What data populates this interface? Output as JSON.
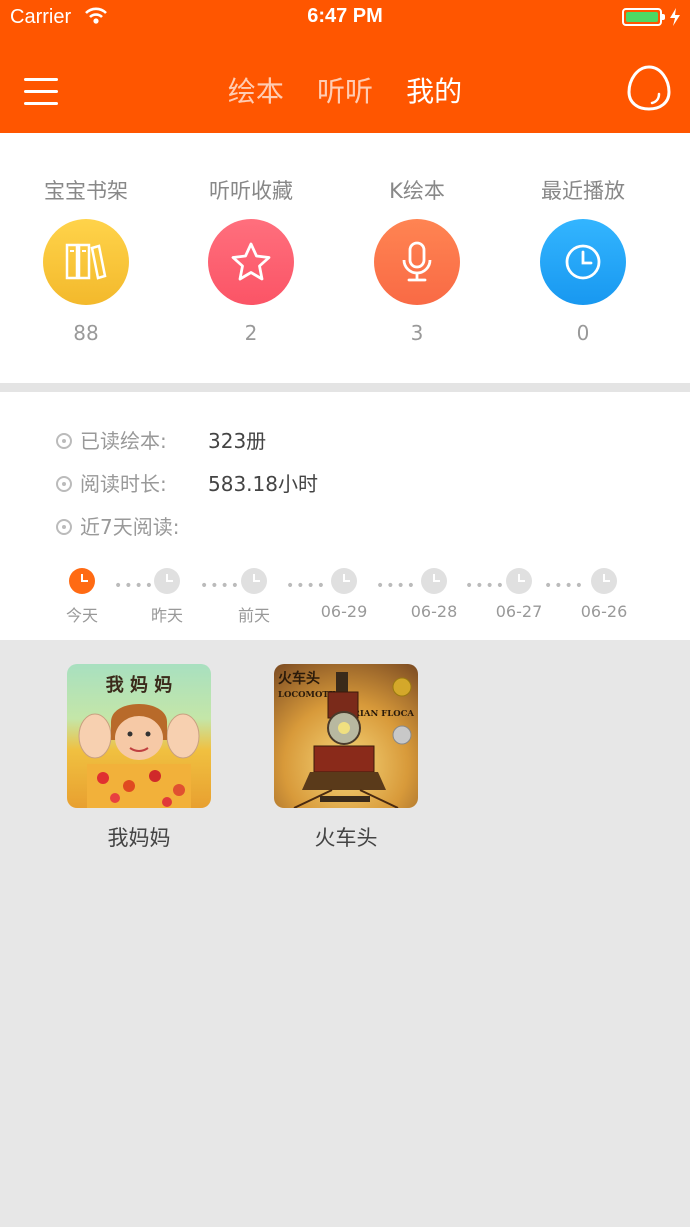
{
  "status_bar": {
    "carrier": "Carrier",
    "time": "6:47 PM"
  },
  "header": {
    "tabs": [
      {
        "label": "绘本",
        "active": false
      },
      {
        "label": "听听",
        "active": false
      },
      {
        "label": "我的",
        "active": true
      }
    ]
  },
  "shortcuts": [
    {
      "label": "宝宝书架",
      "count": "88",
      "icon": "bookshelf-icon",
      "color": "#f5c23a"
    },
    {
      "label": "听听收藏",
      "count": "2",
      "icon": "star-icon",
      "color": "#fc5c6d"
    },
    {
      "label": "K绘本",
      "count": "3",
      "icon": "microphone-icon",
      "color": "#fa744a"
    },
    {
      "label": "最近播放",
      "count": "0",
      "icon": "clock-icon",
      "color": "#24a6f6"
    }
  ],
  "stats": {
    "read_label": "已读绘本:",
    "read_value": "323册",
    "time_label": "阅读时长:",
    "time_value": "583.18小时",
    "week_label": "近7天阅读:"
  },
  "days": [
    "今天",
    "昨天",
    "前天",
    "06-29",
    "06-28",
    "06-27",
    "06-26"
  ],
  "books": [
    {
      "title": "我妈妈",
      "cover_text": "我 妈 妈"
    },
    {
      "title": "火车头",
      "cover_text": "火车头",
      "cover_subtitle": "LOCOMOTIVE",
      "cover_author": "BRIAN FLOCA"
    }
  ],
  "colors": {
    "accent": "#ff5600",
    "active_day": "#ff6a13"
  }
}
